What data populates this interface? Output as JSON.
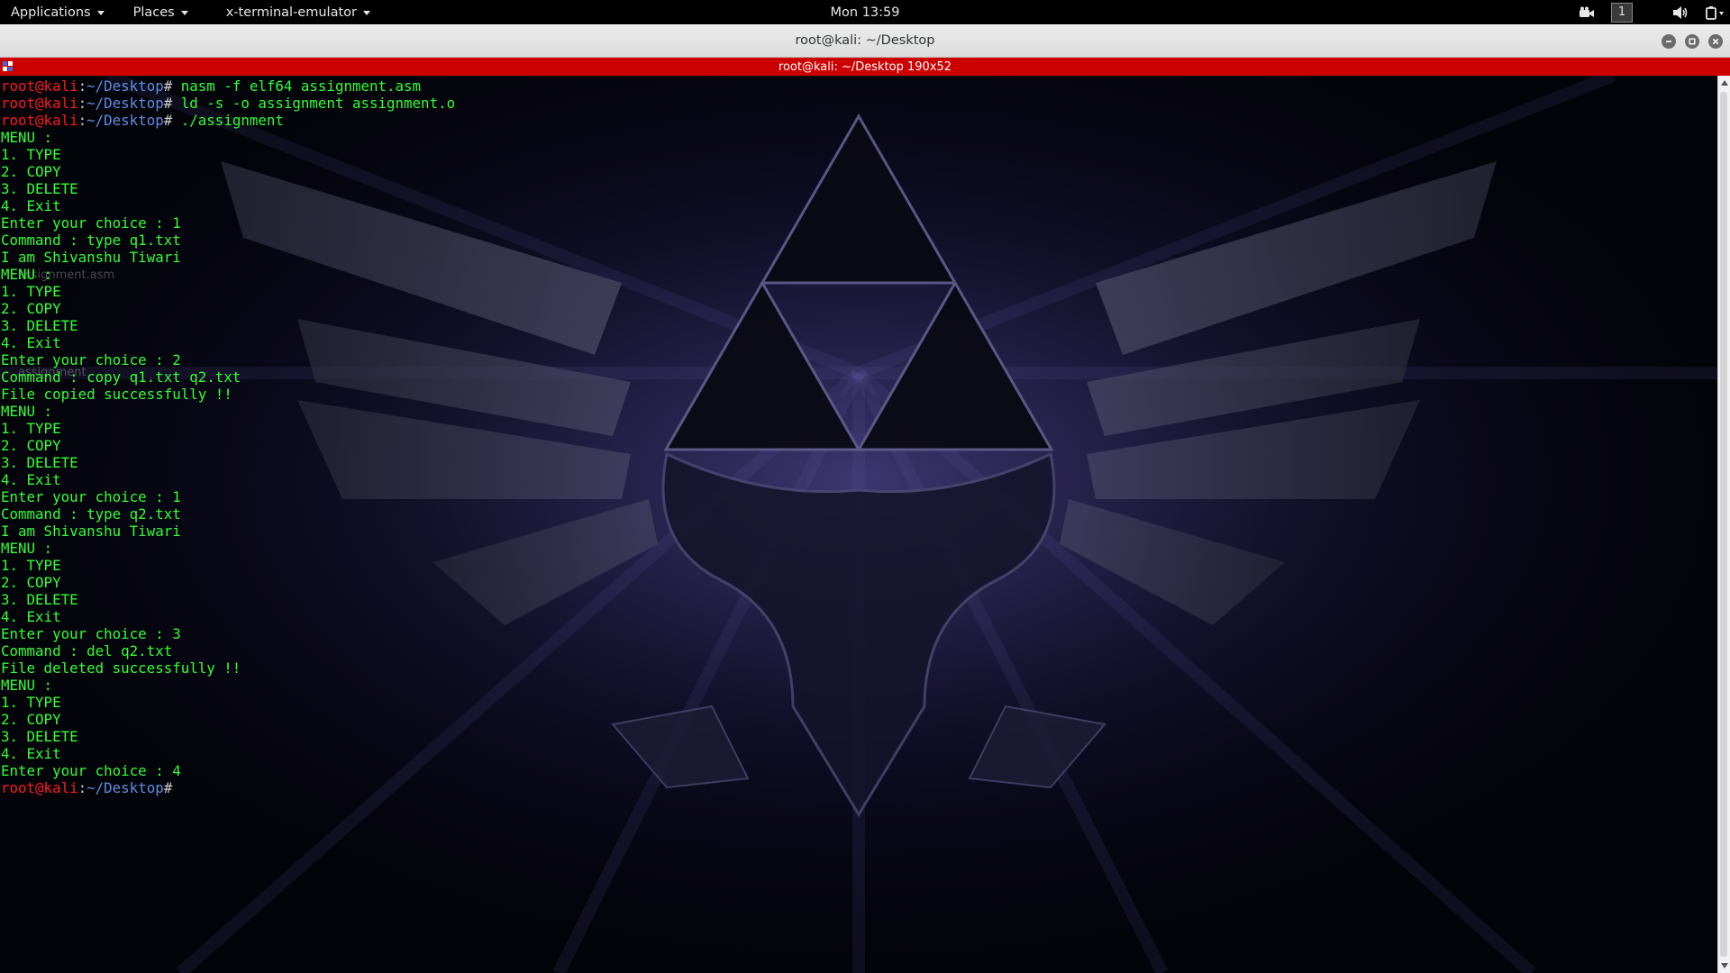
{
  "topbar": {
    "applications_label": "Applications",
    "places_label": "Places",
    "active_app_label": "x-terminal-emulator",
    "clock": "Mon 13:59",
    "workspace_number": "1",
    "tray_icons": [
      "camera-icon",
      "volume-icon",
      "power-icon"
    ]
  },
  "window": {
    "title": "root@kali: ~/Desktop",
    "terminal_header": "root@kali: ~/Desktop 190x52",
    "controls": [
      "minimize-icon",
      "maximize-icon",
      "close-icon"
    ]
  },
  "desktop_ghosts": {
    "label_1": "assignment.asm",
    "label_2": "assignment"
  },
  "terminal": {
    "prompt_user": "root@kali",
    "prompt_sep": ":",
    "prompt_path": "~/Desktop",
    "prompt_symbol": "#",
    "lines": [
      {
        "type": "prompt",
        "cmd": " nasm -f elf64 assignment.asm"
      },
      {
        "type": "prompt",
        "cmd": " ld -s -o assignment assignment.o"
      },
      {
        "type": "prompt",
        "cmd": " ./assignment"
      },
      {
        "type": "out",
        "text": "MENU :"
      },
      {
        "type": "out",
        "text": "1. TYPE"
      },
      {
        "type": "out",
        "text": "2. COPY"
      },
      {
        "type": "out",
        "text": "3. DELETE"
      },
      {
        "type": "out",
        "text": "4. Exit"
      },
      {
        "type": "out",
        "text": "Enter your choice : 1"
      },
      {
        "type": "out",
        "text": "Command : type q1.txt"
      },
      {
        "type": "out",
        "text": "I am Shivanshu Tiwari"
      },
      {
        "type": "out",
        "text": "MENU :"
      },
      {
        "type": "out",
        "text": "1. TYPE"
      },
      {
        "type": "out",
        "text": "2. COPY"
      },
      {
        "type": "out",
        "text": "3. DELETE"
      },
      {
        "type": "out",
        "text": "4. Exit"
      },
      {
        "type": "out",
        "text": "Enter your choice : 2"
      },
      {
        "type": "out",
        "text": "Command : copy q1.txt q2.txt"
      },
      {
        "type": "out",
        "text": "File copied successfully !!"
      },
      {
        "type": "out",
        "text": "MENU :"
      },
      {
        "type": "out",
        "text": "1. TYPE"
      },
      {
        "type": "out",
        "text": "2. COPY"
      },
      {
        "type": "out",
        "text": "3. DELETE"
      },
      {
        "type": "out",
        "text": "4. Exit"
      },
      {
        "type": "out",
        "text": "Enter your choice : 1"
      },
      {
        "type": "out",
        "text": "Command : type q2.txt"
      },
      {
        "type": "out",
        "text": "I am Shivanshu Tiwari"
      },
      {
        "type": "out",
        "text": "MENU :"
      },
      {
        "type": "out",
        "text": "1. TYPE"
      },
      {
        "type": "out",
        "text": "2. COPY"
      },
      {
        "type": "out",
        "text": "3. DELETE"
      },
      {
        "type": "out",
        "text": "4. Exit"
      },
      {
        "type": "out",
        "text": "Enter your choice : 3"
      },
      {
        "type": "out",
        "text": "Command : del q2.txt"
      },
      {
        "type": "out",
        "text": "File deleted successfully !!"
      },
      {
        "type": "out",
        "text": "MENU :"
      },
      {
        "type": "out",
        "text": "1. TYPE"
      },
      {
        "type": "out",
        "text": "2. COPY"
      },
      {
        "type": "out",
        "text": "3. DELETE"
      },
      {
        "type": "out",
        "text": "4. Exit"
      },
      {
        "type": "out",
        "text": "Enter your choice : 4"
      },
      {
        "type": "prompt",
        "cmd": ""
      }
    ]
  },
  "colors": {
    "terminal_header_bg": "#cc0000",
    "prompt_user": "#ff1a1a",
    "prompt_path": "#5d8ee0",
    "output_text": "#33ff33"
  }
}
